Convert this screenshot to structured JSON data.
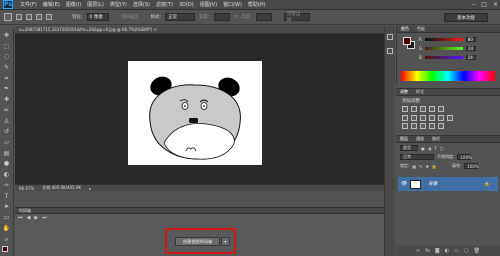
{
  "app": {
    "logo": "Ps"
  },
  "menu": [
    "文件(F)",
    "编辑(E)",
    "图像(I)",
    "图层(L)",
    "类型(Y)",
    "选择(S)",
    "滤镜(T)",
    "3D(D)",
    "视图(V)",
    "窗口(W)",
    "帮助(H)"
  ],
  "window_controls": [
    "–",
    "□",
    "×"
  ],
  "options": {
    "feather_label": "羽化:",
    "feather_value": "0 像素",
    "antialias_label": "消除锯齿",
    "style_label": "样式:",
    "style_value": "正常",
    "width_label": "宽度:",
    "height_label": "高度:",
    "refine_edge": "调整边缘...",
    "workspace": "基本功能"
  },
  "document": {
    "tab_title": "u=2087381715,3337265001&fm=26&gp=0.jpg @ 66.7%(RGB/8*) ×",
    "zoom": "66.67%",
    "doc_size": "文档:405.0K/405.0K"
  },
  "timeline": {
    "title": "时间轴",
    "create_button": "创建视频时间轴",
    "dropdown": "▾"
  },
  "color_panel": {
    "tabs": [
      "颜色",
      "色板"
    ],
    "r_label": "R",
    "r_value": "80",
    "g_label": "G",
    "g_value": "24",
    "b_label": "B",
    "b_value": "24",
    "fg_color": "#500000"
  },
  "adjustments": {
    "tabs": [
      "调整",
      "样式"
    ],
    "title": "添加调整"
  },
  "layers": {
    "tabs": [
      "图层",
      "通道",
      "路径"
    ],
    "kind_label": "类型",
    "blend_mode": "正常",
    "opacity_label": "不透明度:",
    "opacity_value": "100%",
    "lock_label": "锁定:",
    "fill_label": "填充:",
    "fill_value": "100%",
    "layer_name": "背景"
  },
  "icons": {
    "toolbar": [
      "move-tool-icon",
      "marquee-tool-icon",
      "lasso-tool-icon",
      "quick-select-icon",
      "crop-tool-icon",
      "eyedropper-icon",
      "healing-brush-icon",
      "brush-tool-icon",
      "clone-stamp-icon",
      "history-brush-icon",
      "eraser-icon",
      "gradient-icon",
      "blur-icon",
      "dodge-icon",
      "pen-tool-icon",
      "type-tool-icon",
      "path-select-icon",
      "shape-tool-icon",
      "hand-tool-icon",
      "zoom-tool-icon"
    ]
  }
}
